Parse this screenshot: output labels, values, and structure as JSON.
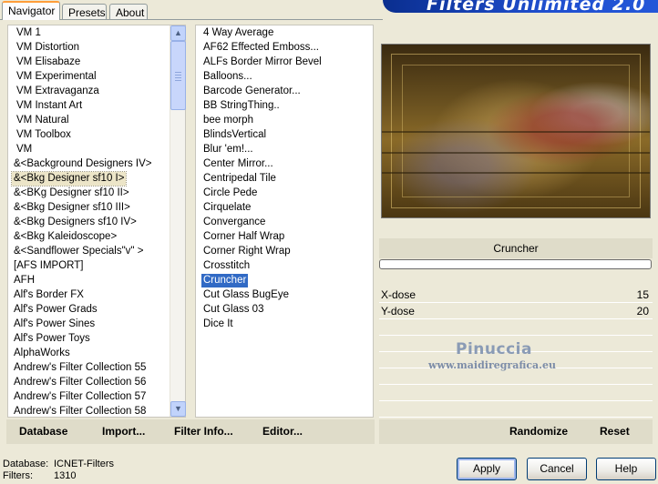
{
  "tabs": [
    {
      "label": "Navigator",
      "active": true
    },
    {
      "label": "Presets",
      "active": false
    },
    {
      "label": "About",
      "active": false
    }
  ],
  "banner_title": "Filters Unlimited 2.0",
  "categories": [
    "VM 1",
    "VM Distortion",
    "VM Elisabaze",
    "VM Experimental",
    "VM Extravaganza",
    "VM Instant Art",
    "VM Natural",
    "VM Toolbox",
    "VM",
    "&<Background Designers IV>",
    "&<Bkg Designer sf10 I>",
    "&<BKg Designer sf10 II>",
    "&<Bkg Designer sf10 III>",
    "&<Bkg Designers sf10 IV>",
    "&<Bkg Kaleidoscope>",
    "&<Sandflower Specials\"v\" >",
    "[AFS IMPORT]",
    "AFH",
    "Alf's Border FX",
    "Alf's Power Grads",
    "Alf's Power Sines",
    "Alf's Power Toys",
    "AlphaWorks",
    "Andrew's Filter Collection 55",
    "Andrew's Filter Collection 56",
    "Andrew's Filter Collection 57",
    "Andrew's Filter Collection 58"
  ],
  "selected_category_index": 10,
  "filters": [
    "4 Way Average",
    "AF62 Effected Emboss...",
    "ALFs Border Mirror Bevel",
    "Balloons...",
    "Barcode Generator...",
    "BB StringThing..",
    "bee morph",
    "BlindsVertical",
    "Blur 'em!...",
    "Center Mirror...",
    "Centripedal Tile",
    "Circle Pede",
    "Cirquelate",
    "Convergance",
    "Corner Half Wrap",
    "Corner Right Wrap",
    "Crosstitch",
    "Cruncher",
    "Cut Glass  BugEye",
    "Cut Glass 03",
    "Dice It"
  ],
  "selected_filter_index": 17,
  "left_buttons": {
    "database": "Database",
    "import": "Import...",
    "filter_info": "Filter Info...",
    "editor": "Editor..."
  },
  "selected_filter_name": "Cruncher",
  "parameters": [
    {
      "name": "X-dose",
      "value": "15"
    },
    {
      "name": "Y-dose",
      "value": "20"
    }
  ],
  "right_buttons": {
    "randomize": "Randomize",
    "reset": "Reset"
  },
  "watermark": {
    "name": "Pinuccia",
    "url": "www.maidiregrafica.eu"
  },
  "status": {
    "database_label": "Database:",
    "database_value": "ICNET-Filters",
    "filters_label": "Filters:",
    "filters_value": "1310"
  },
  "dialog_buttons": {
    "apply": "Apply",
    "cancel": "Cancel",
    "help": "Help"
  },
  "colors": {
    "selection": "#316ac5",
    "banner": "#1f4fcf",
    "tab_active_accent": "#ff9d3a"
  }
}
